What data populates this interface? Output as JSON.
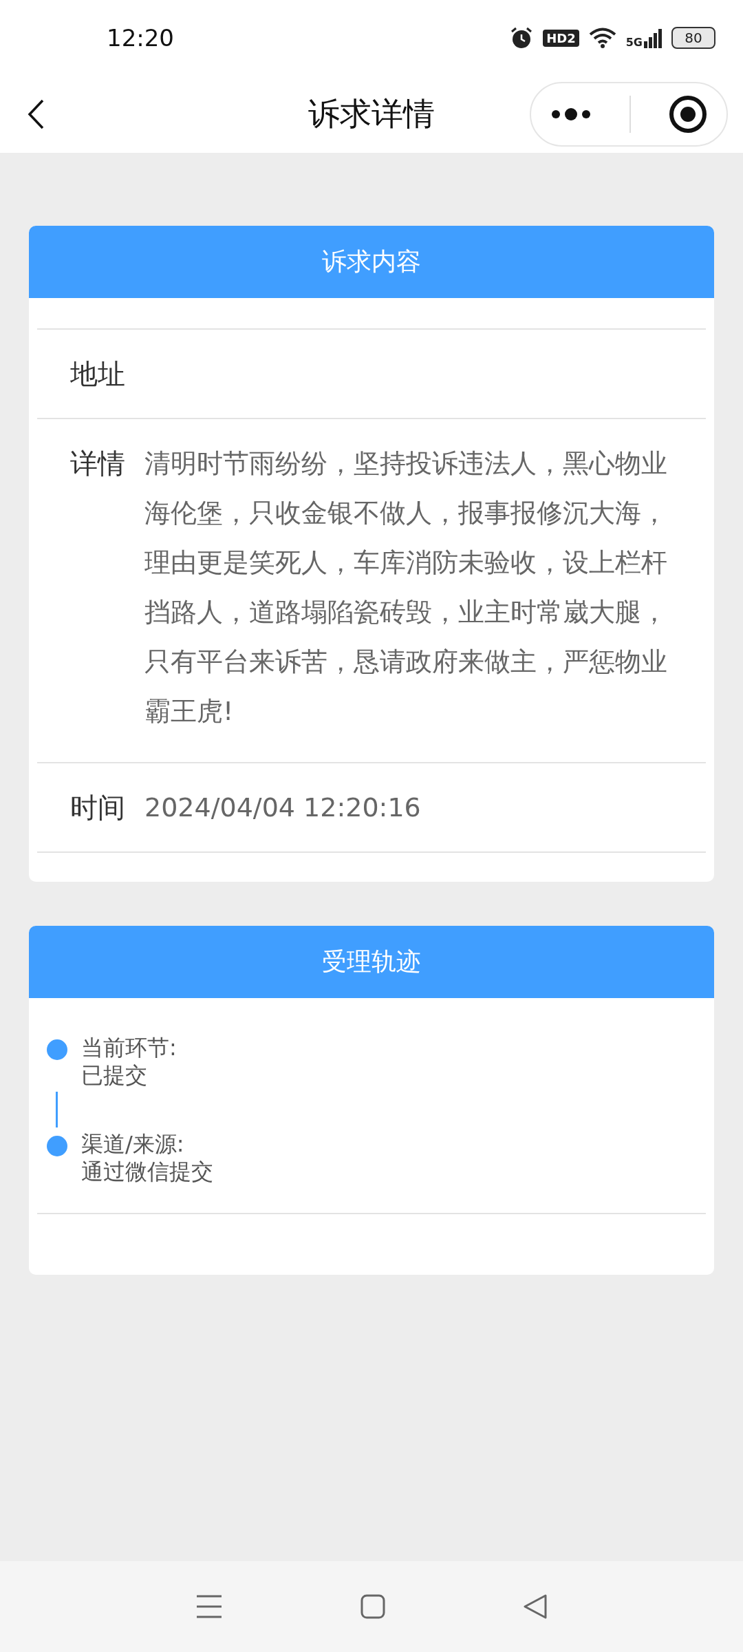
{
  "status_bar": {
    "time": "12:20",
    "hd_badge": "HD2",
    "network": "5G",
    "battery": "80"
  },
  "nav": {
    "title": "诉求详情"
  },
  "content_card": {
    "title": "诉求内容",
    "rows": [
      {
        "label": "地址"
      },
      {
        "label": "详情",
        "value": "清明时节雨纷纷，坚持投诉违法人，黑心物业海伦堡，只收金银不做人，报事报修沉大海，理由更是笑死人，车库消防未验收，设上栏杆挡路人，道路塌陷瓷砖毁，业主时常崴大腿，只有平台来诉苦，恳请政府来做主，严惩物业霸王虎!"
      },
      {
        "label": "时间",
        "value": "2024/04/04 12:20:16"
      }
    ]
  },
  "track_card": {
    "title": "受理轨迹",
    "steps": [
      {
        "label": "当前环节:",
        "value": "已提交"
      },
      {
        "label": "渠道/来源:",
        "value": "通过微信提交"
      }
    ]
  }
}
